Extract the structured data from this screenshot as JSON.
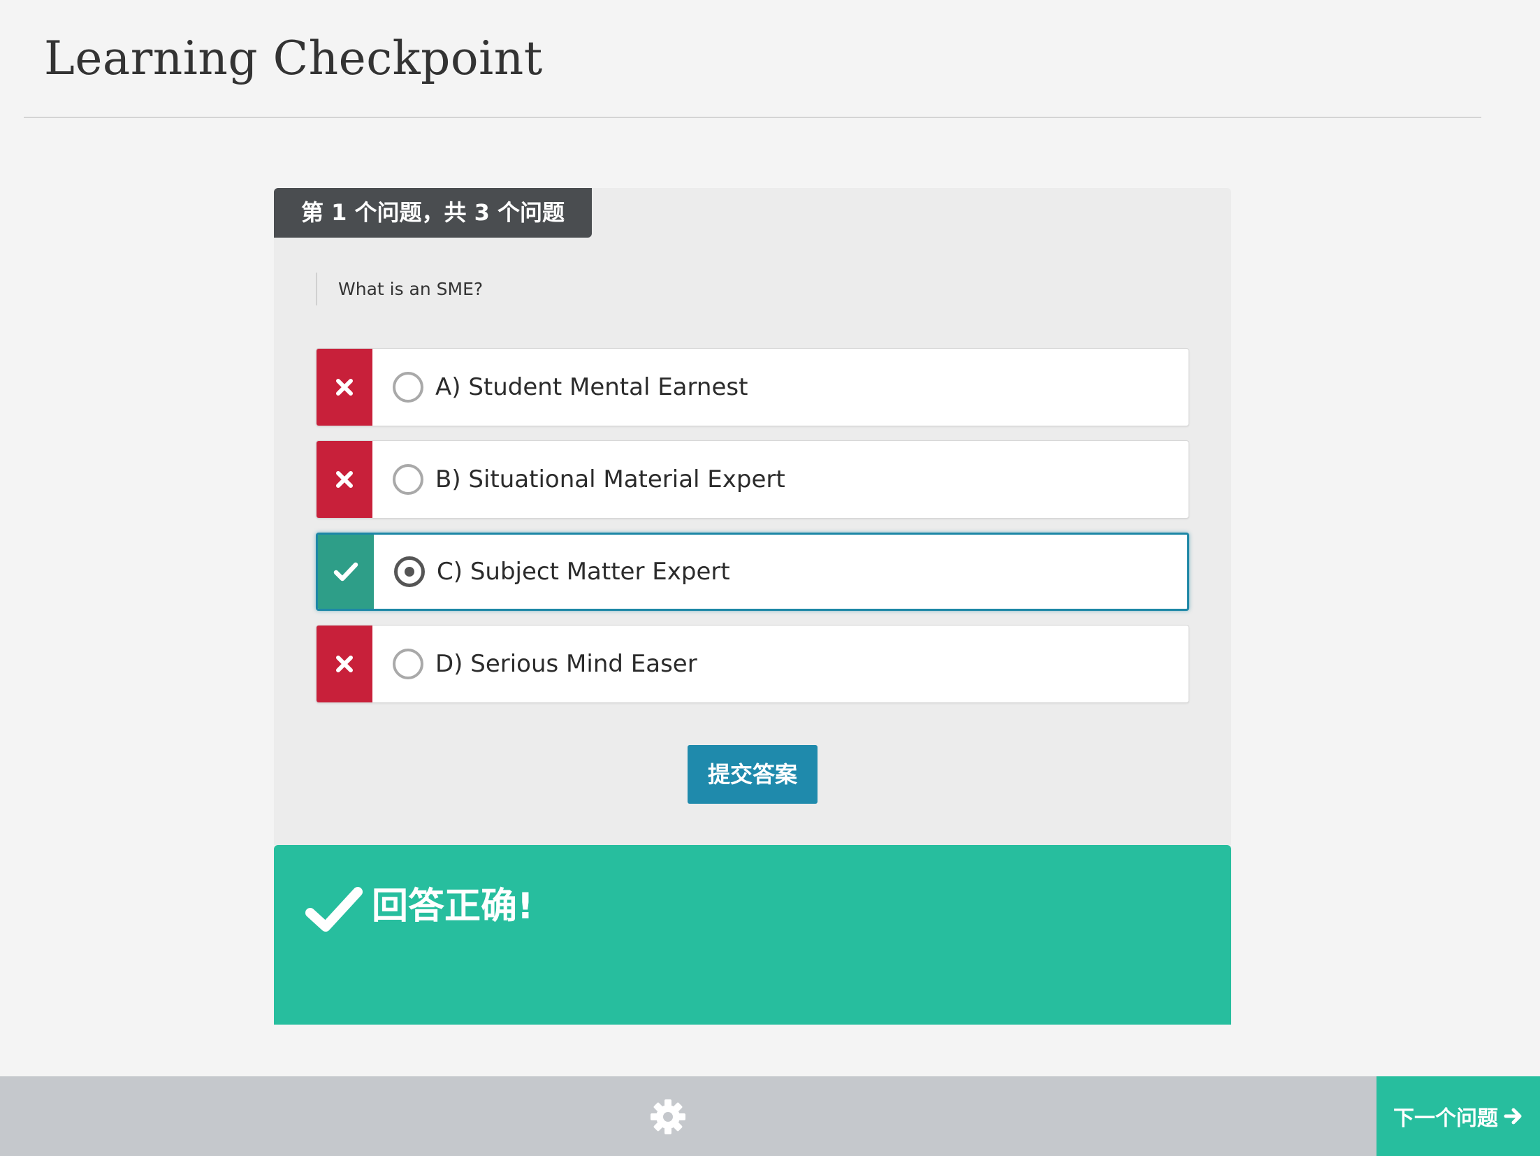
{
  "header": {
    "title": "Learning Checkpoint"
  },
  "quiz": {
    "progress_label": "第 1 个问题，共 3 个问题",
    "question": "What is an SME?",
    "options": [
      {
        "label": "A) Student Mental Earnest",
        "status": "wrong",
        "selected": false,
        "status_icon": "close-icon"
      },
      {
        "label": "B) Situational Material Expert",
        "status": "wrong",
        "selected": false,
        "status_icon": "close-icon"
      },
      {
        "label": "C) Subject Matter Expert",
        "status": "correct",
        "selected": true,
        "status_icon": "check-icon"
      },
      {
        "label": "D) Serious Mind Easer",
        "status": "wrong",
        "selected": false,
        "status_icon": "close-icon"
      }
    ],
    "submit_label": "提交答案"
  },
  "feedback": {
    "icon": "check-icon",
    "text": "回答正确!"
  },
  "footer": {
    "settings_icon": "gear-icon",
    "next_label": "下一个问题",
    "next_icon": "arrow-right-icon"
  },
  "colors": {
    "wrong": "#c8203a",
    "correct": "#2e9e88",
    "accent_blue": "#1f8aac",
    "success_green": "#27be9e",
    "tab_dark": "#4a4d50",
    "bottom_bar": "#c5c8cc"
  }
}
